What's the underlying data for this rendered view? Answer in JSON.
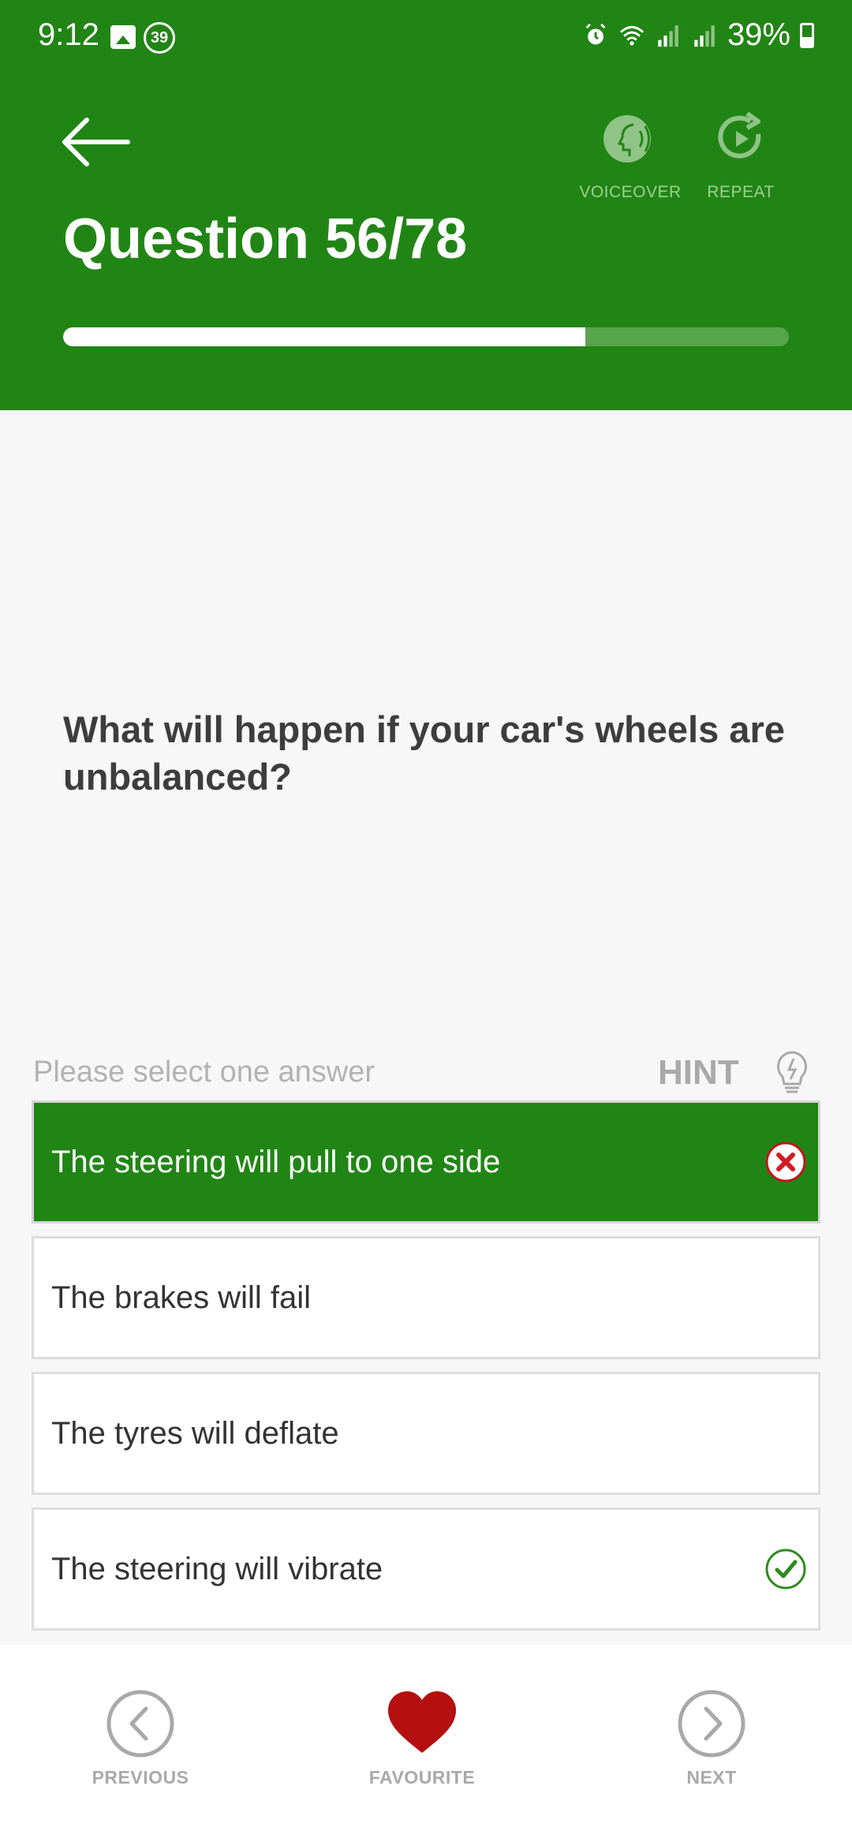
{
  "status_bar": {
    "time": "9:12",
    "notification_badge": "39",
    "battery": "39%",
    "icons": [
      "gallery-icon",
      "alarm-icon",
      "wifi-icon",
      "signal-icon",
      "signal-icon",
      "battery-icon"
    ]
  },
  "header": {
    "title": "Question 56/78",
    "voiceover_label": "VOICEOVER",
    "repeat_label": "REPEAT",
    "progress": 0.72,
    "background_color": "#218515"
  },
  "question": {
    "text": "What will happen if your car's wheels are unbalanced?"
  },
  "answers_section": {
    "instruction": "Please select one answer",
    "hint_label": "HINT"
  },
  "answers": [
    {
      "text": "The steering will pull to one side",
      "state": "selected-wrong",
      "mark": "cross-icon"
    },
    {
      "text": "The brakes will fail",
      "state": "none"
    },
    {
      "text": "The tyres will deflate",
      "state": "none"
    },
    {
      "text": "The steering will vibrate",
      "state": "correct",
      "mark": "check-icon"
    }
  ],
  "bottom_nav": {
    "previous_label": "PREVIOUS",
    "favourite_label": "FAVOURITE",
    "next_label": "NEXT",
    "favourite_color": "#b3100f"
  }
}
